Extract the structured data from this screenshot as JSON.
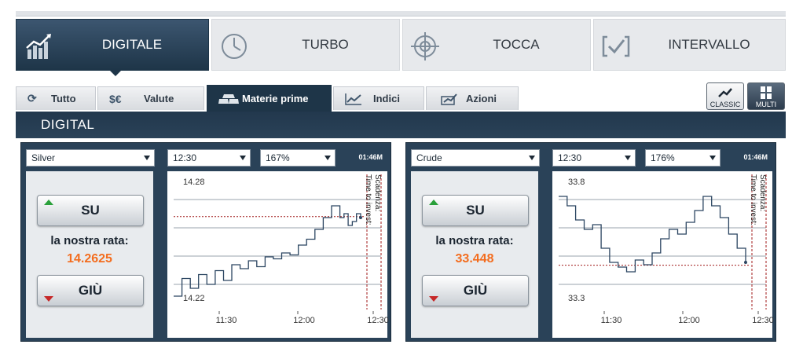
{
  "main_tabs": [
    {
      "label": "DIGITALE",
      "icon": "bar-chart-icon",
      "active": true
    },
    {
      "label": "TURBO",
      "icon": "clock-icon",
      "active": false
    },
    {
      "label": "TOCCA",
      "icon": "target-icon",
      "active": false
    },
    {
      "label": "INTERVALLO",
      "icon": "range-check-icon",
      "active": false
    }
  ],
  "sub_tabs": [
    {
      "label": "Tutto",
      "icon": "refresh-icon",
      "active": false
    },
    {
      "label": "Valute",
      "icon": "currency-icon",
      "active": false
    },
    {
      "label": "Materie prime",
      "icon": "gold-bars-icon",
      "active": true
    },
    {
      "label": "Indici",
      "icon": "line-chart-icon",
      "active": false
    },
    {
      "label": "Azioni",
      "icon": "share-chart-icon",
      "active": false
    }
  ],
  "view_buttons": [
    {
      "label": "CLASSIC",
      "icon": "classic-chart-icon",
      "active": false
    },
    {
      "label": "MULTI",
      "icon": "grid-icon",
      "active": true
    }
  ],
  "section_title": "DIGITAL",
  "colors": {
    "accent": "#f36d1f",
    "header": "#22384d",
    "up": "#2aa03a",
    "down": "#c62828",
    "line": "#2b4561",
    "strike": "#a01a1a"
  },
  "panels": [
    {
      "asset": "Silver",
      "expiry": "12:30",
      "payout": "167%",
      "countdown": "01:46M",
      "up_label": "SU",
      "down_label": "GIÙ",
      "rate_label": "la nostra rata:",
      "rate_value": "14.2625",
      "expiry_text": "Scadenza:",
      "invest_text": "Time to invest:",
      "chart_data": {
        "type": "line",
        "y_top_label": "14.28",
        "y_bottom_label": "14.22",
        "ylim": [
          14.22,
          14.28
        ],
        "x_ticks": [
          "11:30",
          "12:00",
          "12:30"
        ],
        "strike": 14.2625,
        "x": [
          0,
          4,
          8,
          12,
          16,
          20,
          24,
          28,
          32,
          36,
          40,
          44,
          48,
          52,
          56,
          60,
          64,
          68,
          72,
          76,
          80,
          82,
          84,
          86,
          88,
          90
        ],
        "values": [
          14.222,
          14.231,
          14.226,
          14.233,
          14.228,
          14.235,
          14.23,
          14.238,
          14.236,
          14.24,
          14.237,
          14.242,
          14.241,
          14.244,
          14.243,
          14.248,
          14.251,
          14.256,
          14.262,
          14.268,
          14.262,
          14.264,
          14.258,
          14.26,
          14.264,
          14.262
        ]
      }
    },
    {
      "asset": "Crude",
      "expiry": "12:30",
      "payout": "176%",
      "countdown": "01:46M",
      "up_label": "SU",
      "down_label": "GIÙ",
      "rate_label": "la nostra rata:",
      "rate_value": "33.448",
      "expiry_text": "Scadenza:",
      "invest_text": "Time to invest:",
      "chart_data": {
        "type": "line",
        "y_top_label": "33.8",
        "y_bottom_label": "33.3",
        "ylim": [
          33.3,
          33.8
        ],
        "x_ticks": [
          "11:30",
          "12:00",
          "12:30"
        ],
        "strike": 33.448,
        "x": [
          0,
          4,
          8,
          12,
          16,
          20,
          24,
          28,
          32,
          36,
          40,
          44,
          48,
          52,
          56,
          60,
          64,
          68,
          72,
          76,
          80,
          84,
          88
        ],
        "values": [
          33.74,
          33.7,
          33.64,
          33.6,
          33.62,
          33.52,
          33.46,
          33.44,
          33.42,
          33.47,
          33.45,
          33.5,
          33.56,
          33.6,
          33.58,
          33.63,
          33.68,
          33.74,
          33.7,
          33.65,
          33.58,
          33.52,
          33.46
        ]
      }
    }
  ]
}
